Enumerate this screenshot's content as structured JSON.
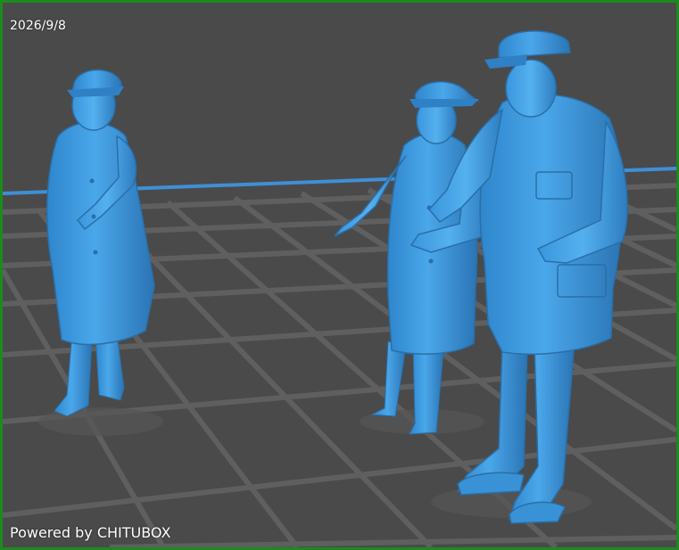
{
  "viewport": {
    "date": "2026/9/8",
    "watermark": "Powered by CHITUBOX"
  },
  "colors": {
    "frame": "#1d8a1d",
    "background": "#4a4a4a",
    "grid": "#5f5f5f",
    "plate_edge": "#3f8fd6",
    "model": "#3d9be0",
    "model_shadow": "#2a6fa8",
    "model_highlight": "#7cc4f5"
  },
  "scene": {
    "models": [
      {
        "name": "figure-left",
        "description_icon": "standing-man-cap-pointing"
      },
      {
        "name": "figure-middle",
        "description_icon": "standing-man-cap-coat"
      },
      {
        "name": "figure-right",
        "description_icon": "standing-man-cap-jacket"
      }
    ]
  }
}
